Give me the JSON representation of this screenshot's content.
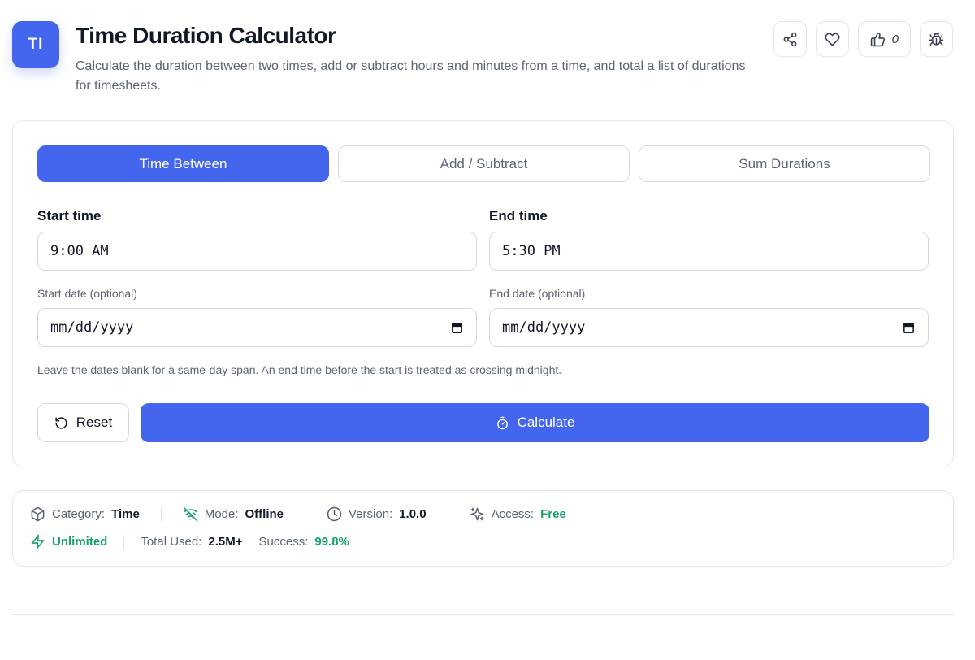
{
  "header": {
    "logo_text": "TI",
    "title": "Time Duration Calculator",
    "subtitle": "Calculate the duration between two times, add or subtract hours and minutes from a time, and total a list of durations for timesheets.",
    "like_count": "0"
  },
  "tabs": [
    {
      "label": "Time Between",
      "active": true
    },
    {
      "label": "Add / Subtract",
      "active": false
    },
    {
      "label": "Sum Durations",
      "active": false
    }
  ],
  "form": {
    "start_time_label": "Start time",
    "start_time_value": "9:00 AM",
    "end_time_label": "End time",
    "end_time_value": "5:30 PM",
    "start_date_label": "Start date (optional)",
    "start_date_placeholder": "mm/dd/yyyy",
    "end_date_label": "End date (optional)",
    "end_date_placeholder": "mm/dd/yyyy",
    "hint": "Leave the dates blank for a same-day span. An end time before the start is treated as crossing midnight.",
    "reset_label": "Reset",
    "calculate_label": "Calculate"
  },
  "meta": {
    "category_label": "Category:",
    "category_value": "Time",
    "mode_label": "Mode:",
    "mode_value": "Offline",
    "version_label": "Version:",
    "version_value": "1.0.0",
    "access_label": "Access:",
    "access_value": "Free",
    "unlimited_label": "Unlimited",
    "total_used_label": "Total Used:",
    "total_used_value": "2.5M+",
    "success_label": "Success:",
    "success_value": "99.8%"
  },
  "colors": {
    "accent": "#4466ee",
    "success": "#16a36a",
    "muted_text": "#5b6473",
    "border": "#e3e6ea"
  },
  "icons": [
    "share-icon",
    "heart-icon",
    "thumbs-up-icon",
    "bug-icon",
    "calendar-icon",
    "reset-icon",
    "stopwatch-icon",
    "box-icon",
    "wifi-off-icon",
    "clock-icon",
    "sparkles-icon",
    "zap-icon"
  ]
}
